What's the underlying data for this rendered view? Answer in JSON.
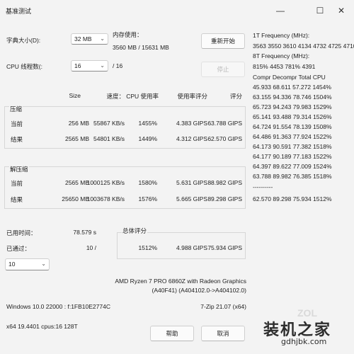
{
  "window": {
    "title": "基准测试",
    "minimize_glyph": "—",
    "maximize_glyph": "☐",
    "close_glyph": "✕"
  },
  "settings": {
    "dict_label": "字典大小(D):",
    "dict_value": "32 MB",
    "mem_label": "内存使用：",
    "mem_value": "3560 MB / 15631 MB",
    "threads_label": "CPU 线程数(:",
    "threads_value": "16",
    "threads_total": "/ 16",
    "restart_label": "重新开始",
    "stop_label": "停止"
  },
  "columns": {
    "size": "Size",
    "speed": "速度：",
    "cpu": "CPU 使用率",
    "rating_per_usage": "使用率评分",
    "rating": "评分"
  },
  "compress": {
    "heading": "压缩",
    "rows": [
      {
        "label": "当前",
        "size": "256 MB",
        "speed": "55867 KB/s",
        "cpu": "1455%",
        "rpu": "4.383 GIPS",
        "rating": "63.788 GIPS"
      },
      {
        "label": "结果",
        "size": "2565 MB",
        "speed": "54801 KB/s",
        "cpu": "1449%",
        "rpu": "4.312 GIPS",
        "rating": "62.570 GIPS"
      }
    ]
  },
  "decompress": {
    "heading": "解压缩",
    "rows": [
      {
        "label": "当前",
        "size": "2565 MB",
        "speed": "1000125 KB/s",
        "cpu": "1580%",
        "rpu": "5.631 GIPS",
        "rating": "88.982 GIPS"
      },
      {
        "label": "结果",
        "size": "25650 MB",
        "speed": "1003678 KB/s",
        "cpu": "1576%",
        "rpu": "5.665 GIPS",
        "rating": "89.298 GIPS"
      }
    ]
  },
  "status": {
    "elapsed_label": "已用时间：",
    "elapsed_value": "78.579 s",
    "passes_label": "已通过：",
    "passes_value": "10 /",
    "passes_select": "10",
    "total_label": "总体评分",
    "total_cpu": "1512%",
    "total_rpu": "4.988 GIPS",
    "total_rating": "75.934 GIPS"
  },
  "system": {
    "cpu_line1": "AMD Ryzen 7 PRO 6860Z with Radeon Graphics",
    "cpu_line2": "(A40F41) (A404102.0->A404102.0)",
    "os": "Windows 10.0 22000 : f:1FB10E2774C",
    "version": "7-Zip 21.07 (x64)",
    "arch": "x64 19.4401 cpus:16 128T"
  },
  "buttons": {
    "help": "帮助",
    "cancel": "取消"
  },
  "freq": {
    "line1": "1T Frequency (MHz):",
    "line2": " 3563 3550 3610 4134 4732 4725 4710",
    "line3": "8T Frequency (MHz):",
    "line4": " 815% 4453 781% 4391",
    "header": "Compr Decompr Total  CPU",
    "rows": [
      "45.933 68.611 57.272 1454%",
      "63.155 94.336 78.746 1504%",
      "65.723 94.243 79.983 1529%",
      "65.141 93.488 79.314 1526%",
      "64.724 91.554 78.139 1508%",
      "64.486 91.363 77.924 1522%",
      "64.173 90.591 77.382 1518%",
      "64.177 90.189 77.183 1522%",
      "64.397 89.622 77.009 1524%",
      "63.788 89.982 76.385 1518%"
    ],
    "separator": "----------",
    "total_row": "62.570 89.298 75.934 1512%"
  },
  "watermark": {
    "main": "装机之家",
    "sub": "gdhjbk.com",
    "logo_text": "ZOL"
  }
}
